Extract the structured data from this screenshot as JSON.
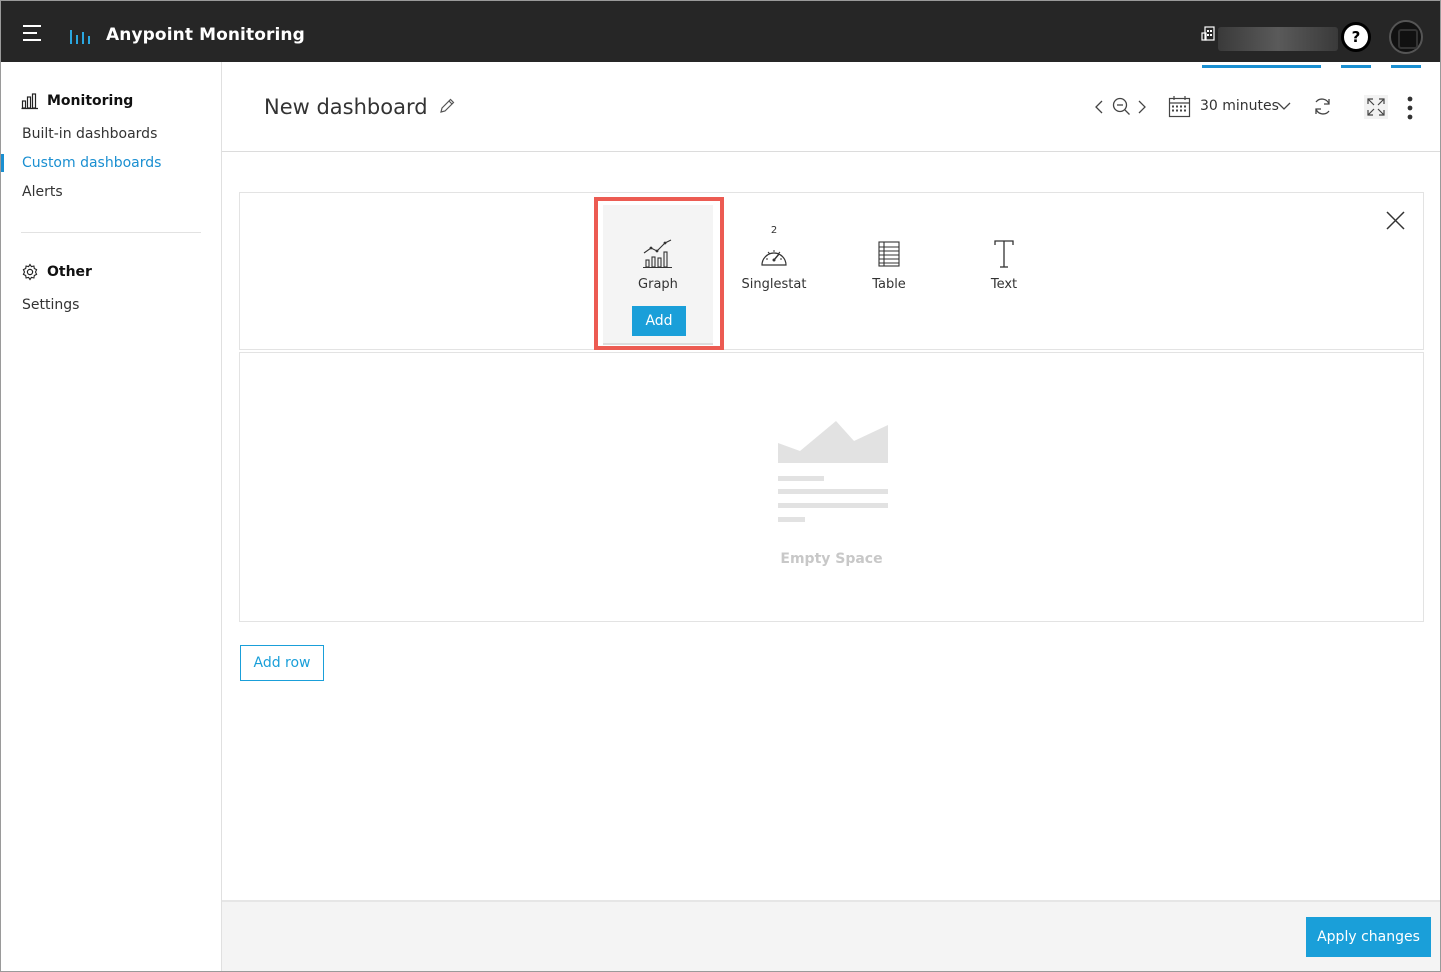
{
  "app": {
    "title": "Anypoint Monitoring",
    "help_label": "?"
  },
  "sidebar": {
    "monitoring_heading": "Monitoring",
    "monitoring_items": [
      {
        "label": "Built-in dashboards",
        "active": false
      },
      {
        "label": "Custom dashboards",
        "active": true
      },
      {
        "label": "Alerts",
        "active": false
      }
    ],
    "other_heading": "Other",
    "other_items": [
      {
        "label": "Settings"
      }
    ]
  },
  "dashboard": {
    "title": "New dashboard",
    "time_range": "30 minutes"
  },
  "panel_picker": {
    "options": [
      {
        "label": "Graph",
        "icon": "graph-icon",
        "selected": true,
        "add_label": "Add"
      },
      {
        "label": "Singlestat",
        "icon": "gauge-icon",
        "badge": "2"
      },
      {
        "label": "Table",
        "icon": "table-icon"
      },
      {
        "label": "Text",
        "icon": "text-icon"
      }
    ]
  },
  "empty_row": {
    "label": "Empty Space"
  },
  "actions": {
    "add_row": "Add row",
    "apply_changes": "Apply changes"
  },
  "colors": {
    "accent": "#1a9fd9",
    "topbar": "#262626",
    "highlight": "#ec5b52"
  }
}
